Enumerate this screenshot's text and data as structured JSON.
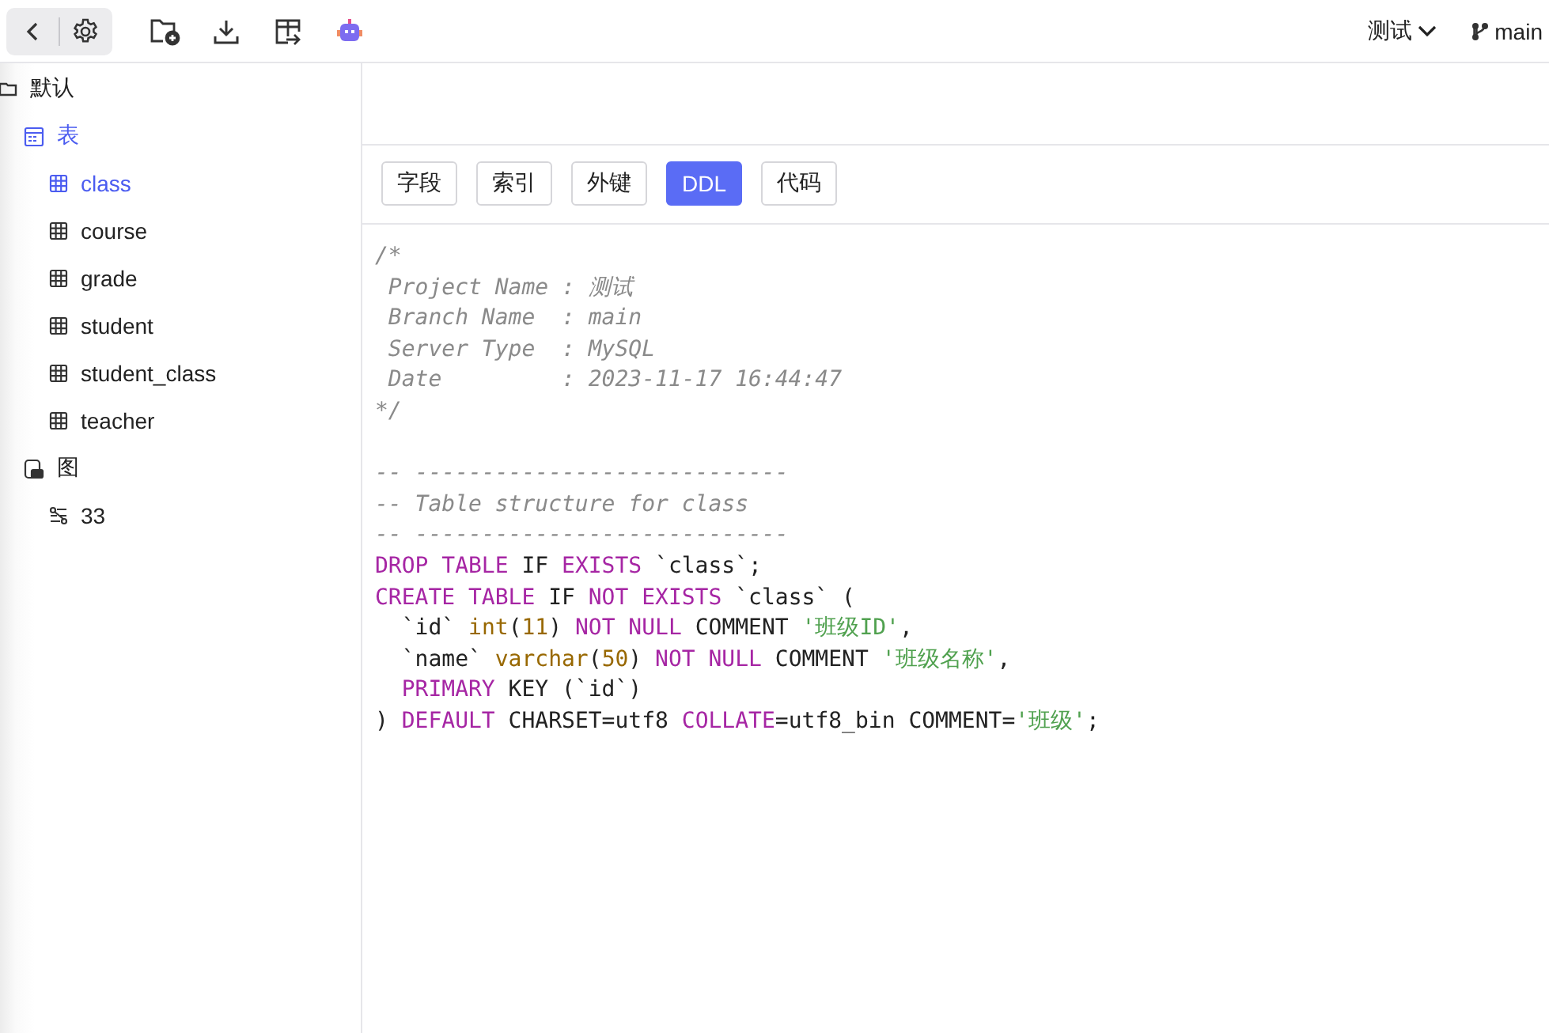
{
  "toolbar": {
    "project": "测试",
    "branch": "main"
  },
  "sidebar": {
    "tree": [
      {
        "label": "默认",
        "kind": "root",
        "selected": false,
        "children": [
          {
            "label": "表",
            "kind": "tables",
            "selected": true,
            "children": [
              {
                "label": "class",
                "kind": "table",
                "selected": true
              },
              {
                "label": "course",
                "kind": "table",
                "selected": false
              },
              {
                "label": "grade",
                "kind": "table",
                "selected": false
              },
              {
                "label": "student",
                "kind": "table",
                "selected": false
              },
              {
                "label": "student_class",
                "kind": "table",
                "selected": false
              },
              {
                "label": "teacher",
                "kind": "table",
                "selected": false
              }
            ]
          },
          {
            "label": "图",
            "kind": "diagrams",
            "selected": false,
            "children": [
              {
                "label": "33",
                "kind": "diagram",
                "selected": false
              }
            ]
          }
        ]
      }
    ]
  },
  "tabs": [
    {
      "label": "字段",
      "selected": false
    },
    {
      "label": "索引",
      "selected": false
    },
    {
      "label": "外键",
      "selected": false
    },
    {
      "label": "DDL",
      "selected": true
    },
    {
      "label": "代码",
      "selected": false
    }
  ],
  "code": {
    "blocks": [
      {
        "lines": [
          [
            {
              "kind": "comment",
              "text": "/*"
            }
          ],
          [
            {
              "kind": "comment",
              "text": " Project Name : 测试"
            }
          ],
          [
            {
              "kind": "comment",
              "text": " Branch Name  : main"
            }
          ],
          [
            {
              "kind": "comment",
              "text": " Server Type  : MySQL"
            }
          ],
          [
            {
              "kind": "comment",
              "text": " Date         : 2023-11-17 16:44:47"
            }
          ],
          [
            {
              "kind": "comment",
              "text": "*/"
            }
          ]
        ]
      },
      {
        "lines": [
          [
            {
              "kind": "comment",
              "text": "-- ----------------------------"
            }
          ],
          [
            {
              "kind": "comment",
              "text": "-- Table structure for class"
            }
          ],
          [
            {
              "kind": "comment",
              "text": "-- ----------------------------"
            }
          ],
          [
            {
              "kind": "keyword",
              "text": "DROP TABLE"
            },
            {
              "kind": "plain",
              "text": " IF "
            },
            {
              "kind": "keyword",
              "text": "EXISTS"
            },
            {
              "kind": "plain",
              "text": " `class`;"
            }
          ],
          [
            {
              "kind": "keyword",
              "text": "CREATE TABLE"
            },
            {
              "kind": "plain",
              "text": " IF "
            },
            {
              "kind": "keyword",
              "text": "NOT EXISTS"
            },
            {
              "kind": "plain",
              "text": " `class` ("
            }
          ],
          [
            {
              "kind": "plain",
              "text": "  `id` "
            },
            {
              "kind": "type",
              "text": "int"
            },
            {
              "kind": "plain",
              "text": "("
            },
            {
              "kind": "number",
              "text": "11"
            },
            {
              "kind": "plain",
              "text": ") "
            },
            {
              "kind": "keyword",
              "text": "NOT NULL"
            },
            {
              "kind": "plain",
              "text": " COMMENT "
            },
            {
              "kind": "string",
              "text": "'班级ID'"
            },
            {
              "kind": "plain",
              "text": ","
            }
          ],
          [
            {
              "kind": "plain",
              "text": "  `name` "
            },
            {
              "kind": "type",
              "text": "varchar"
            },
            {
              "kind": "plain",
              "text": "("
            },
            {
              "kind": "number",
              "text": "50"
            },
            {
              "kind": "plain",
              "text": ") "
            },
            {
              "kind": "keyword",
              "text": "NOT NULL"
            },
            {
              "kind": "plain",
              "text": " COMMENT "
            },
            {
              "kind": "string",
              "text": "'班级名称'"
            },
            {
              "kind": "plain",
              "text": ","
            }
          ],
          [
            {
              "kind": "keyword",
              "text": "  PRIMARY"
            },
            {
              "kind": "plain",
              "text": " KEY (`id`)"
            }
          ],
          [
            {
              "kind": "plain",
              "text": ") "
            },
            {
              "kind": "keyword",
              "text": "DEFAULT"
            },
            {
              "kind": "plain",
              "text": " CHARSET=utf8 "
            },
            {
              "kind": "keyword",
              "text": "COLLATE"
            },
            {
              "kind": "plain",
              "text": "=utf8_bin COMMENT="
            },
            {
              "kind": "string",
              "text": "'班级'"
            },
            {
              "kind": "plain",
              "text": ";"
            }
          ]
        ]
      }
    ]
  }
}
